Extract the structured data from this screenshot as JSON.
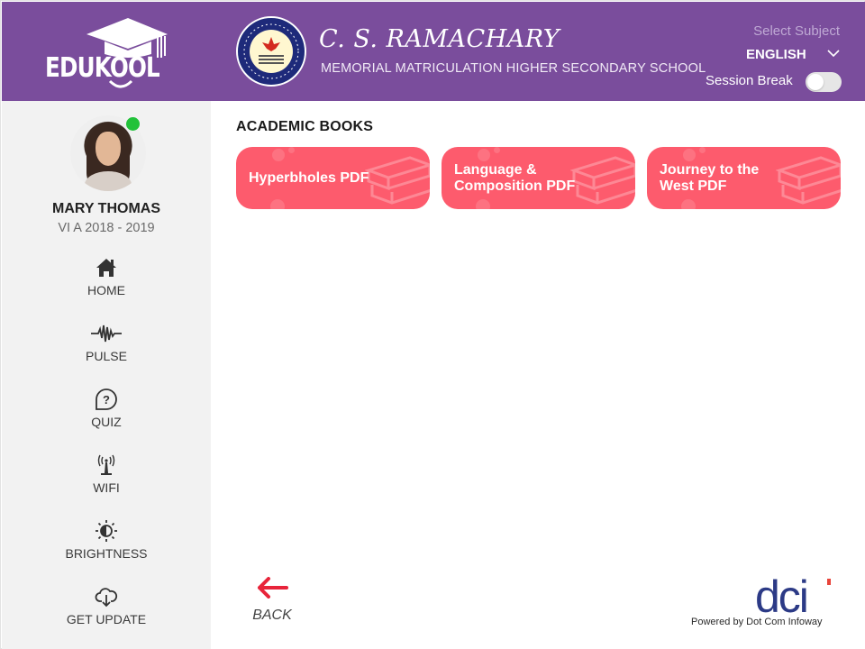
{
  "header": {
    "logo_text": "EDUKOOL",
    "school_name": "C. S. RAMACHARY",
    "school_subtitle": "MEMORIAL MATRICULATION HIGHER SECONDARY SCHOOL",
    "subject_label": "Select Subject",
    "subject_value": "ENGLISH",
    "session_break_label": "Session Break",
    "session_break_on": false,
    "brand_color": "#7a4d9c"
  },
  "user": {
    "name": "MARY THOMAS",
    "class_info": "VI A 2018 - 2019",
    "status": "online"
  },
  "sidebar": {
    "items": [
      {
        "label": "HOME",
        "icon": "home-icon"
      },
      {
        "label": "PULSE",
        "icon": "pulse-icon"
      },
      {
        "label": "QUIZ",
        "icon": "quiz-icon"
      },
      {
        "label": "WIFI",
        "icon": "wifi-icon"
      },
      {
        "label": "BRIGHTNESS",
        "icon": "brightness-icon"
      },
      {
        "label": "GET UPDATE",
        "icon": "cloud-download-icon"
      }
    ]
  },
  "main": {
    "section_title": "ACADEMIC BOOKS",
    "books": [
      {
        "title": "Hyperbholes PDF"
      },
      {
        "title": "Language & Composition PDF"
      },
      {
        "title": "Journey to the West PDF"
      }
    ],
    "card_color": "#fd5b6d",
    "back_label": "BACK"
  },
  "footer": {
    "brand": "dci",
    "powered_by": "Powered by Dot Com Infoway"
  }
}
